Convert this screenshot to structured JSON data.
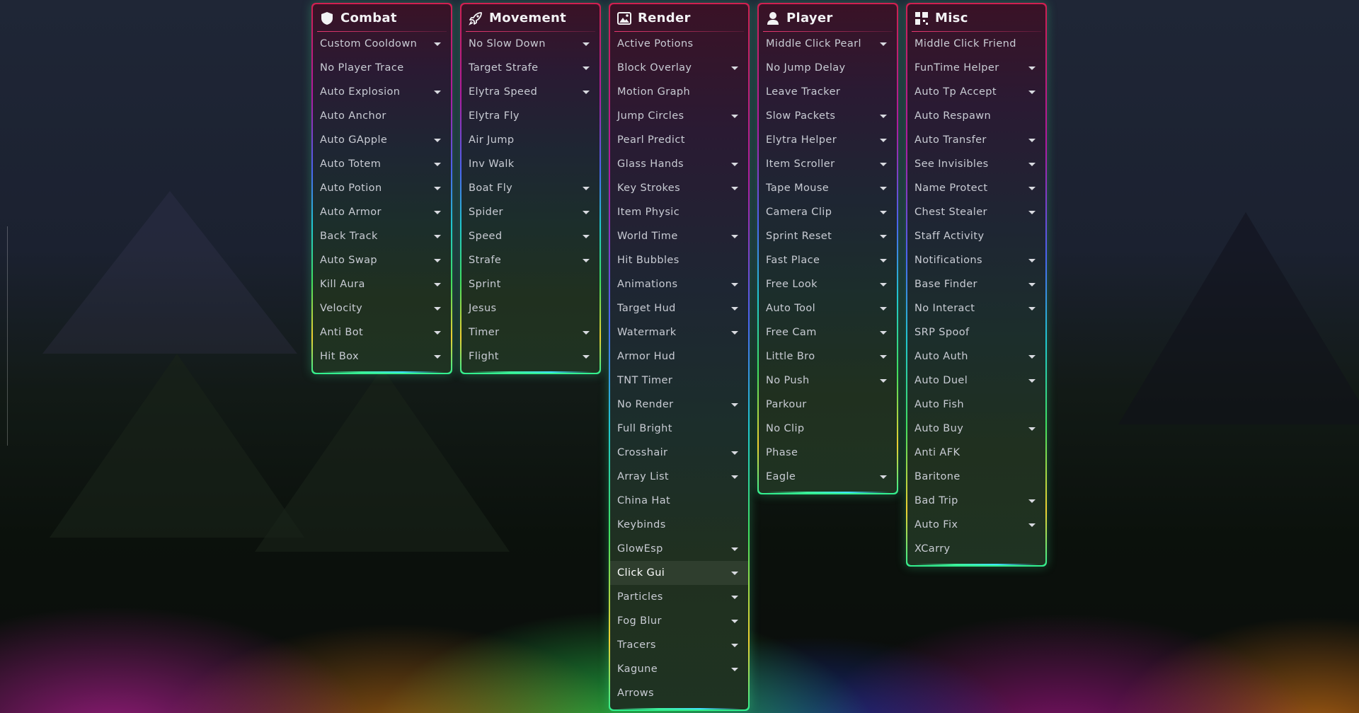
{
  "theme": {
    "text_color": "#c9ccd4",
    "title_color": "#f2f2f4",
    "accent_top": "#d02050",
    "accent_bottom": "#30f090"
  },
  "categories": [
    {
      "id": "combat",
      "title": "Combat",
      "icon": "shield-icon",
      "modules": [
        {
          "name": "Custom Cooldown",
          "has_settings": true
        },
        {
          "name": "No Player Trace",
          "has_settings": false
        },
        {
          "name": "Auto Explosion",
          "has_settings": true
        },
        {
          "name": "Auto Anchor",
          "has_settings": false
        },
        {
          "name": "Auto GApple",
          "has_settings": true
        },
        {
          "name": "Auto Totem",
          "has_settings": true
        },
        {
          "name": "Auto Potion",
          "has_settings": true
        },
        {
          "name": "Auto Armor",
          "has_settings": true
        },
        {
          "name": "Back Track",
          "has_settings": true
        },
        {
          "name": "Auto Swap",
          "has_settings": true
        },
        {
          "name": "Kill Aura",
          "has_settings": true
        },
        {
          "name": "Velocity",
          "has_settings": true
        },
        {
          "name": "Anti Bot",
          "has_settings": true
        },
        {
          "name": "Hit Box",
          "has_settings": true
        }
      ]
    },
    {
      "id": "movement",
      "title": "Movement",
      "icon": "rocket-icon",
      "modules": [
        {
          "name": "No Slow Down",
          "has_settings": true
        },
        {
          "name": "Target Strafe",
          "has_settings": true
        },
        {
          "name": "Elytra Speed",
          "has_settings": true
        },
        {
          "name": "Elytra Fly",
          "has_settings": false
        },
        {
          "name": "Air Jump",
          "has_settings": false
        },
        {
          "name": "Inv Walk",
          "has_settings": false
        },
        {
          "name": "Boat Fly",
          "has_settings": true
        },
        {
          "name": "Spider",
          "has_settings": true
        },
        {
          "name": "Speed",
          "has_settings": true
        },
        {
          "name": "Strafe",
          "has_settings": true
        },
        {
          "name": "Sprint",
          "has_settings": false
        },
        {
          "name": "Jesus",
          "has_settings": false
        },
        {
          "name": "Timer",
          "has_settings": true
        },
        {
          "name": "Flight",
          "has_settings": true
        }
      ]
    },
    {
      "id": "render",
      "title": "Render",
      "icon": "image-icon",
      "modules": [
        {
          "name": "Active Potions",
          "has_settings": false
        },
        {
          "name": "Block Overlay",
          "has_settings": true
        },
        {
          "name": "Motion Graph",
          "has_settings": false
        },
        {
          "name": "Jump Circles",
          "has_settings": true
        },
        {
          "name": "Pearl Predict",
          "has_settings": false
        },
        {
          "name": "Glass Hands",
          "has_settings": true
        },
        {
          "name": "Key Strokes",
          "has_settings": true
        },
        {
          "name": "Item Physic",
          "has_settings": false
        },
        {
          "name": "World Time",
          "has_settings": true
        },
        {
          "name": "Hit Bubbles",
          "has_settings": false
        },
        {
          "name": "Animations",
          "has_settings": true
        },
        {
          "name": "Target Hud",
          "has_settings": true
        },
        {
          "name": "Watermark",
          "has_settings": true
        },
        {
          "name": "Armor Hud",
          "has_settings": false
        },
        {
          "name": "TNT Timer",
          "has_settings": false
        },
        {
          "name": "No Render",
          "has_settings": true
        },
        {
          "name": "Full Bright",
          "has_settings": false
        },
        {
          "name": "Crosshair",
          "has_settings": true
        },
        {
          "name": "Array List",
          "has_settings": true
        },
        {
          "name": "China Hat",
          "has_settings": false
        },
        {
          "name": "Keybinds",
          "has_settings": false
        },
        {
          "name": "GlowEsp",
          "has_settings": true
        },
        {
          "name": "Click Gui",
          "has_settings": true,
          "active": true
        },
        {
          "name": "Particles",
          "has_settings": true
        },
        {
          "name": "Fog Blur",
          "has_settings": true
        },
        {
          "name": "Tracers",
          "has_settings": true
        },
        {
          "name": "Kagune",
          "has_settings": true
        },
        {
          "name": "Arrows",
          "has_settings": false
        }
      ]
    },
    {
      "id": "player",
      "title": "Player",
      "icon": "user-icon",
      "modules": [
        {
          "name": "Middle Click Pearl",
          "has_settings": true
        },
        {
          "name": "No Jump Delay",
          "has_settings": false
        },
        {
          "name": "Leave Tracker",
          "has_settings": false
        },
        {
          "name": "Slow Packets",
          "has_settings": true
        },
        {
          "name": "Elytra Helper",
          "has_settings": true
        },
        {
          "name": "Item Scroller",
          "has_settings": true
        },
        {
          "name": "Tape Mouse",
          "has_settings": true
        },
        {
          "name": "Camera Clip",
          "has_settings": true
        },
        {
          "name": "Sprint Reset",
          "has_settings": true
        },
        {
          "name": "Fast Place",
          "has_settings": true
        },
        {
          "name": "Free Look",
          "has_settings": true
        },
        {
          "name": "Auto Tool",
          "has_settings": true
        },
        {
          "name": "Free Cam",
          "has_settings": true
        },
        {
          "name": "Little Bro",
          "has_settings": true
        },
        {
          "name": "No Push",
          "has_settings": true
        },
        {
          "name": "Parkour",
          "has_settings": false
        },
        {
          "name": "No Clip",
          "has_settings": false
        },
        {
          "name": "Phase",
          "has_settings": false
        },
        {
          "name": "Eagle",
          "has_settings": true
        }
      ]
    },
    {
      "id": "misc",
      "title": "Misc",
      "icon": "grid-icon",
      "modules": [
        {
          "name": "Middle Click Friend",
          "has_settings": false
        },
        {
          "name": "FunTime Helper",
          "has_settings": true
        },
        {
          "name": "Auto Tp Accept",
          "has_settings": true
        },
        {
          "name": "Auto Respawn",
          "has_settings": false
        },
        {
          "name": "Auto Transfer",
          "has_settings": true
        },
        {
          "name": "See Invisibles",
          "has_settings": true
        },
        {
          "name": "Name Protect",
          "has_settings": true
        },
        {
          "name": "Chest Stealer",
          "has_settings": true
        },
        {
          "name": "Staff Activity",
          "has_settings": false
        },
        {
          "name": "Notifications",
          "has_settings": true
        },
        {
          "name": "Base Finder",
          "has_settings": true
        },
        {
          "name": "No Interact",
          "has_settings": true
        },
        {
          "name": "SRP Spoof",
          "has_settings": false
        },
        {
          "name": "Auto Auth",
          "has_settings": true
        },
        {
          "name": "Auto Duel",
          "has_settings": true
        },
        {
          "name": "Auto Fish",
          "has_settings": false
        },
        {
          "name": "Auto Buy",
          "has_settings": true
        },
        {
          "name": "Anti AFK",
          "has_settings": false
        },
        {
          "name": "Baritone",
          "has_settings": false
        },
        {
          "name": "Bad Trip",
          "has_settings": true
        },
        {
          "name": "Auto Fix",
          "has_settings": true
        },
        {
          "name": "XCarry",
          "has_settings": false
        }
      ]
    }
  ]
}
